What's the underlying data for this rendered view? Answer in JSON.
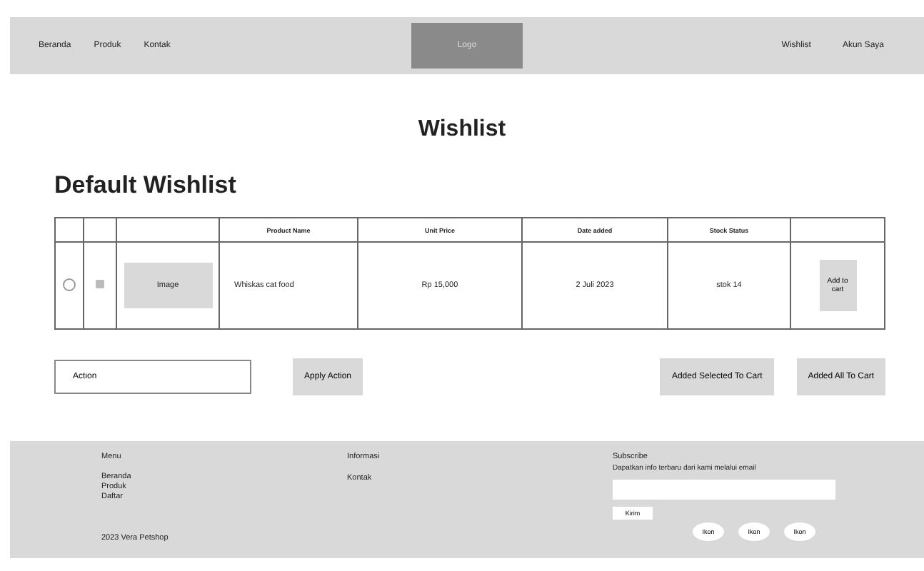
{
  "nav": {
    "left_links": [
      "Beranda",
      "Produk",
      "Kontak"
    ],
    "logo": "Logo",
    "right_links": [
      "Wishlist",
      "Akun Saya"
    ]
  },
  "page_title": "Wishlist",
  "wishlist_title": "Default Wishlist",
  "table": {
    "columns": [
      "Product Name",
      "Unit Price",
      "Date added",
      "Stock Status"
    ],
    "rows": [
      {
        "selected": false,
        "checked": false,
        "image": "Image",
        "product_name": "Whiskas cat food",
        "unit_price": "Rp 15,000",
        "date_added": "2 Juli 2023",
        "stock_status": "stok 14",
        "action": "Add to cart"
      }
    ]
  },
  "action_field": {
    "value": "Action"
  },
  "buttons": [
    "Apply Action",
    "Added Selected To Cart",
    "Added All To Cart"
  ],
  "footer": {
    "menu_title": "Menu",
    "menu_links": [
      "Beranda",
      "Produk",
      "Daftar"
    ],
    "copyright": "2023 Vera Petshop",
    "info_links": [
      "Informasi",
      "Kontak"
    ],
    "subscribe_title": "Subscribe",
    "subscribe_text": "Dapatkan info terbaru dari kami melalui email",
    "send_button": "Kirim",
    "social_buttons": [
      "Ikon",
      "Ikon",
      "Ikon"
    ]
  }
}
